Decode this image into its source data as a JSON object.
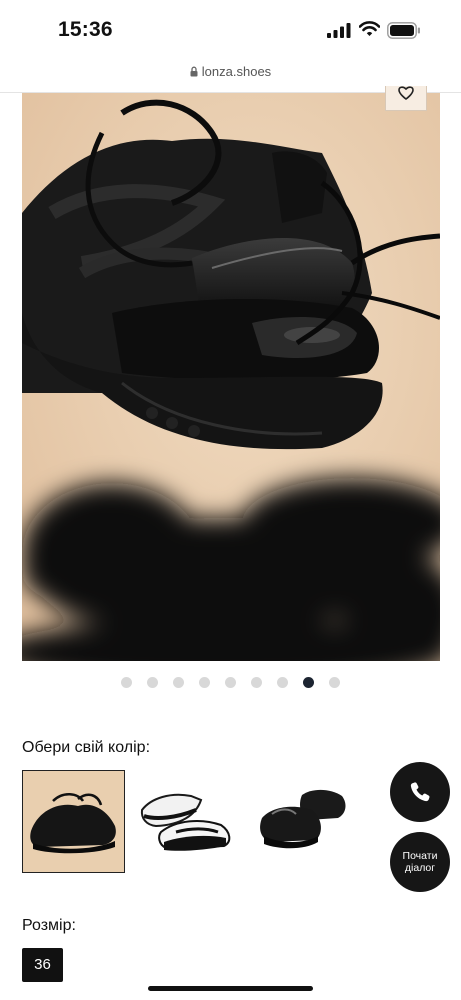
{
  "status": {
    "time": "15:36"
  },
  "browser": {
    "url": "lonza.shoes"
  },
  "gallery": {
    "total_slides": 9,
    "active_slide": 8
  },
  "product": {
    "color_label": "Обери свій колір:",
    "size_label": "Розмір:",
    "selected_size": "36"
  },
  "contact": {
    "chat_label": "Почати діалог"
  },
  "icons": {
    "status": [
      "signal-icon",
      "wifi-icon",
      "battery-icon"
    ],
    "url": "lock-icon",
    "gallery": "heart-icon",
    "call": "phone-icon"
  },
  "colors": {
    "accent": "#161616",
    "dot_active": "#1c2431",
    "dot_inactive": "#d8d8d8",
    "photo_bg": "#ecd3b5"
  }
}
